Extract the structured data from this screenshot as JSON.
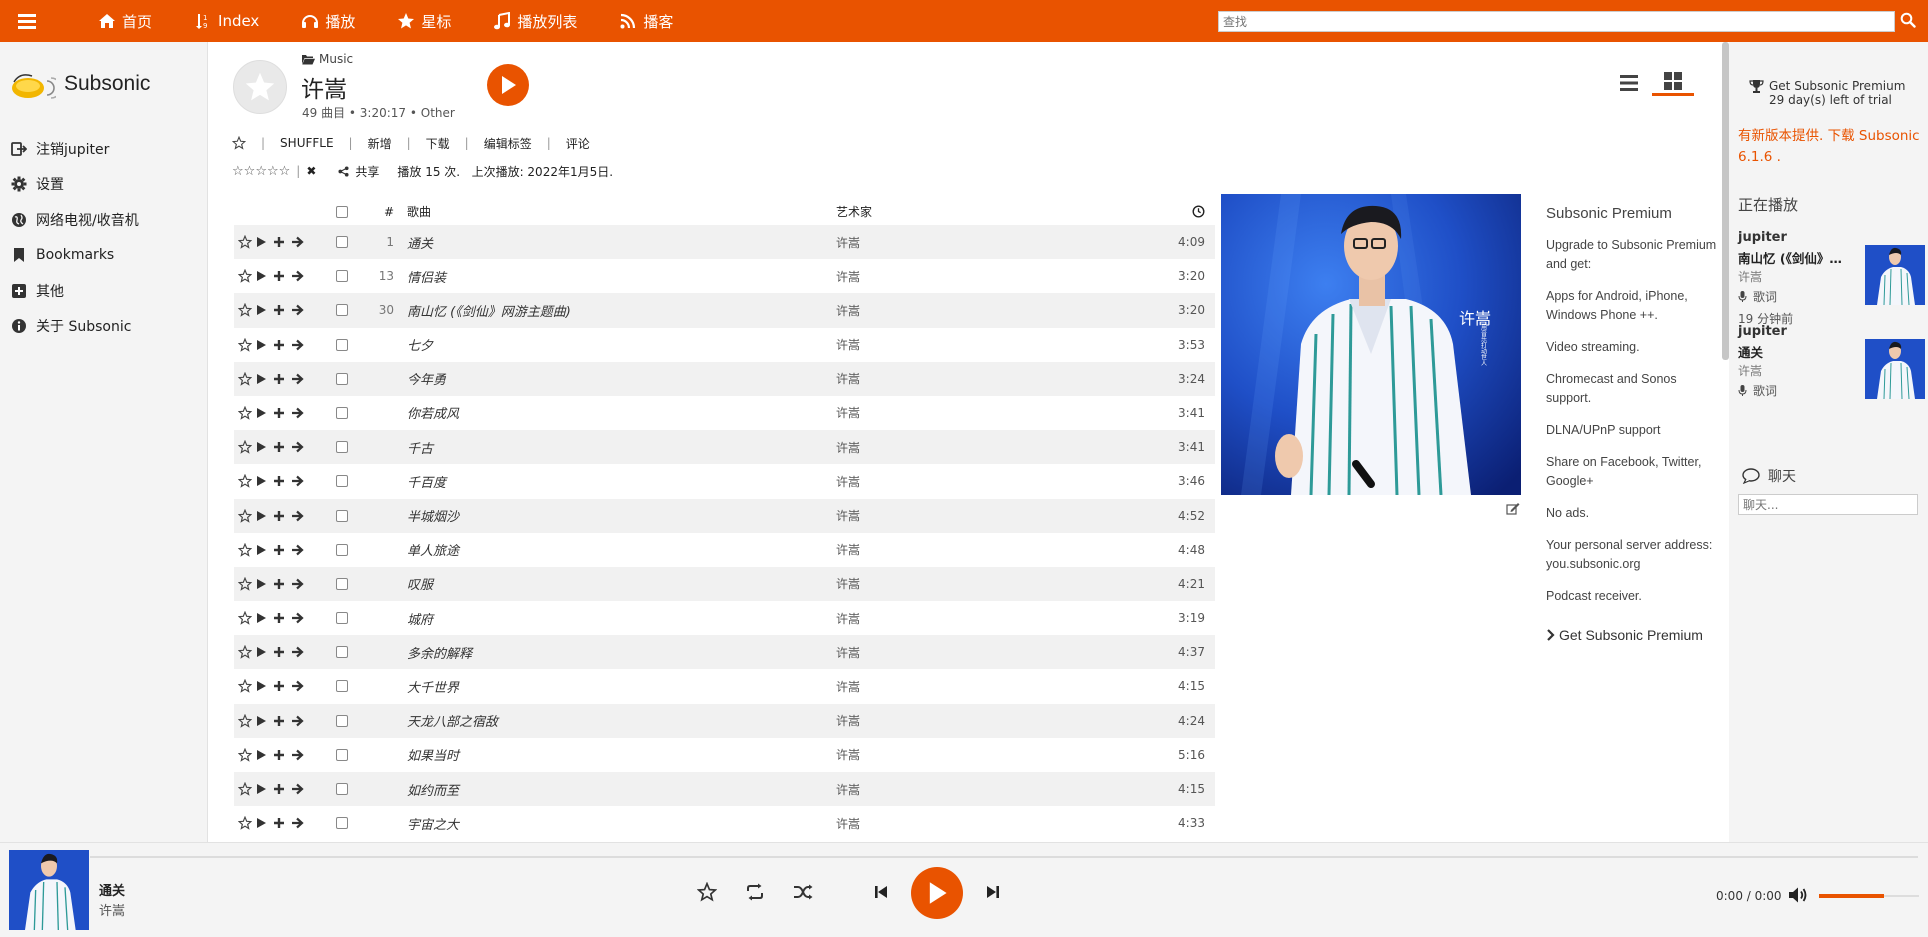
{
  "nav": {
    "items": [
      {
        "label": "首页",
        "icon": "home-icon"
      },
      {
        "label": "Index",
        "icon": "sort-icon"
      },
      {
        "label": "播放",
        "icon": "headphones-icon"
      },
      {
        "label": "星标",
        "icon": "star-icon"
      },
      {
        "label": "播放列表",
        "icon": "music-icon"
      },
      {
        "label": "播客",
        "icon": "rss-icon"
      }
    ],
    "search_placeholder": "查找"
  },
  "sidebar": {
    "app_name": "Subsonic",
    "links": [
      {
        "label": "注销jupiter",
        "icon": "logout-icon"
      },
      {
        "label": "设置",
        "icon": "gear-icon"
      },
      {
        "label": "网络电视/收音机",
        "icon": "globe-icon"
      },
      {
        "label": "Bookmarks",
        "icon": "bookmark-icon"
      },
      {
        "label": "其他",
        "icon": "plus-square-icon"
      },
      {
        "label": "关于 Subsonic",
        "icon": "info-icon"
      }
    ]
  },
  "album": {
    "breadcrumb": "Music",
    "title": "许嵩",
    "meta": "49 曲目  •  3:20:17  •  Other",
    "actions": [
      "SHUFFLE",
      "新增",
      "下载",
      "编辑标签",
      "评论"
    ],
    "share": "共享",
    "play_stats": "播放 15 次.   上次播放: 2022年1月5日."
  },
  "tracks": {
    "header": {
      "num": "#",
      "title": "歌曲",
      "artist": "艺术家"
    },
    "rows": [
      {
        "num": "1",
        "title": "通关",
        "artist": "许嵩",
        "duration": "4:09"
      },
      {
        "num": "13",
        "title": "情侣装",
        "artist": "许嵩",
        "duration": "3:20"
      },
      {
        "num": "30",
        "title": "南山忆 (《剑仙》网游主题曲)",
        "artist": "许嵩",
        "duration": "3:20"
      },
      {
        "num": "",
        "title": "七夕",
        "artist": "许嵩",
        "duration": "3:53"
      },
      {
        "num": "",
        "title": "今年勇",
        "artist": "许嵩",
        "duration": "3:24"
      },
      {
        "num": "",
        "title": "你若成风",
        "artist": "许嵩",
        "duration": "3:41"
      },
      {
        "num": "",
        "title": "千古",
        "artist": "许嵩",
        "duration": "3:41"
      },
      {
        "num": "",
        "title": "千百度",
        "artist": "许嵩",
        "duration": "3:46"
      },
      {
        "num": "",
        "title": "半城烟沙",
        "artist": "许嵩",
        "duration": "4:52"
      },
      {
        "num": "",
        "title": "单人旅途",
        "artist": "许嵩",
        "duration": "4:48"
      },
      {
        "num": "",
        "title": "叹服",
        "artist": "许嵩",
        "duration": "4:21"
      },
      {
        "num": "",
        "title": "城府",
        "artist": "许嵩",
        "duration": "3:19"
      },
      {
        "num": "",
        "title": "多余的解释",
        "artist": "许嵩",
        "duration": "4:37"
      },
      {
        "num": "",
        "title": "大千世界",
        "artist": "许嵩",
        "duration": "4:15"
      },
      {
        "num": "",
        "title": "天龙八部之宿敌",
        "artist": "许嵩",
        "duration": "4:24"
      },
      {
        "num": "",
        "title": "如果当时",
        "artist": "许嵩",
        "duration": "5:16"
      },
      {
        "num": "",
        "title": "如约而至",
        "artist": "许嵩",
        "duration": "4:15"
      },
      {
        "num": "",
        "title": "宇宙之大",
        "artist": "许嵩",
        "duration": "4:33"
      }
    ]
  },
  "cover_text": {
    "name": "许嵩",
    "caption": "用音乐打动世人"
  },
  "promo": {
    "title": "Subsonic Premium",
    "items": [
      "Upgrade to Subsonic Premium and get:",
      "Apps for Android, iPhone, Windows Phone ++.",
      "Video streaming.",
      "Chromecast and Sonos support.",
      "DLNA/UPnP support",
      "Share on Facebook, Twitter, Google+",
      "No ads.",
      "Your personal server address: you.subsonic.org",
      "Podcast receiver."
    ],
    "link": "Get Subsonic Premium"
  },
  "right_panel": {
    "premium_title": "Get Subsonic Premium",
    "premium_days": "29 day(s) left of trial",
    "update_notice": "有新版本提供. 下载 Subsonic 6.1.6 .",
    "now_playing_title": "正在播放",
    "now_playing": [
      {
        "user": "jupiter",
        "song": "南山忆 (《剑仙》网游主题曲)",
        "artist": "许嵩",
        "lyrics": "歌词",
        "time": "19 分钟前"
      },
      {
        "user": "jupiter",
        "song": "通关",
        "artist": "许嵩",
        "lyrics": "歌词",
        "time": ""
      }
    ],
    "chat_title": "聊天",
    "chat_placeholder": "聊天..."
  },
  "player": {
    "song": "通关",
    "artist": "许嵩",
    "time": "0:00 / 0:00",
    "progress": 0,
    "volume": 0.65
  },
  "colors": {
    "accent": "#e95300",
    "sidebar_bg": "#f4f4f4",
    "row_alt": "#f1f1f1"
  }
}
